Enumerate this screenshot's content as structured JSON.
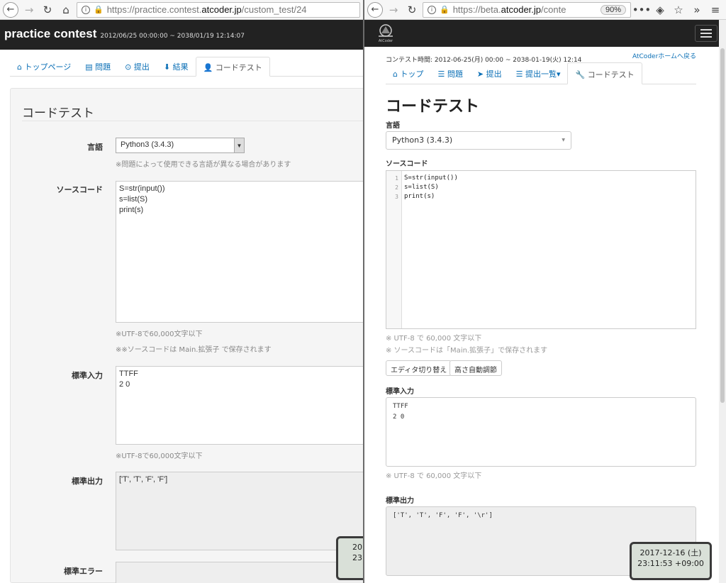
{
  "left": {
    "url_prefix": "https://practice.contest.",
    "url_domain": "atcoder.jp",
    "url_suffix": "/custom_test/24",
    "contest_title": "practice contest",
    "contest_dates": "2012/06/25 00:00:00 ~ 2038/01/19 12:14:07",
    "tabs": [
      {
        "icon": "⌂",
        "label": "トップページ"
      },
      {
        "icon": "▤",
        "label": "問題"
      },
      {
        "icon": "⊙",
        "label": "提出"
      },
      {
        "icon": "⬇",
        "label": "結果"
      },
      {
        "icon": "👤",
        "label": "コードテスト"
      }
    ],
    "heading": "コードテスト",
    "language_label": "言語",
    "language_value": "Python3 (3.4.3)",
    "language_help": "※問題によって使用できる言語が異なる場合があります",
    "source_label": "ソースコード",
    "source_code": "S=str(input())\ns=list(S)\nprint(s)",
    "source_help1": "※UTF-8で60,000文字以下",
    "source_help2": "※※ソースコードは Main.拡張子 で保存されます",
    "stdin_label": "標準入力",
    "stdin_value": "TTFF\n2 0",
    "stdin_help": "※UTF-8で60,000文字以下",
    "stdout_label": "標準出力",
    "stdout_value": "['T', 'T', 'F', 'F']",
    "stderr_label": "標準エラー",
    "clock_line1": "20",
    "clock_line2": "23"
  },
  "right": {
    "url_prefix": "https://beta.",
    "url_domain": "atcoder.jp",
    "url_suffix": "/conte",
    "zoom": "90%",
    "logo_text": "AtCoder",
    "contest_time": "コンテスト時間: 2012-06-25(月) 00:00 ~ 2038-01-19(火) 12:14",
    "home_link": "AtCoderホームへ戻る",
    "tabs": [
      {
        "icon": "⌂",
        "label": "トップ"
      },
      {
        "icon": "☰",
        "label": "問題"
      },
      {
        "icon": "➤",
        "label": "提出"
      },
      {
        "icon": "☰",
        "label": "提出一覧▾"
      },
      {
        "icon": "🔧",
        "label": "コードテスト"
      }
    ],
    "heading": "コードテスト",
    "language_label": "言語",
    "language_value": "Python3 (3.4.3)",
    "source_label": "ソースコード",
    "line_numbers": "1\n2\n3",
    "source_code": "S=str(input())\ns=list(S)\nprint(s)",
    "source_help1": "※ UTF-8 で 60,000 文字以下",
    "source_help2": "※ ソースコードは「Main.拡張子」で保存されます",
    "toggle_editor": "エディタ切り替え",
    "auto_height": "高さ自動調節",
    "stdin_label": "標準入力",
    "stdin_value": "TTFF\n2 0",
    "stdin_help": "※ UTF-8 で 60,000 文字以下",
    "stdout_label": "標準出力",
    "stdout_value": "['T', 'T', 'F', 'F', '\\r']",
    "clock_line1": "2017-12-16 (土)",
    "clock_line2": "23:11:53 +09:00"
  }
}
